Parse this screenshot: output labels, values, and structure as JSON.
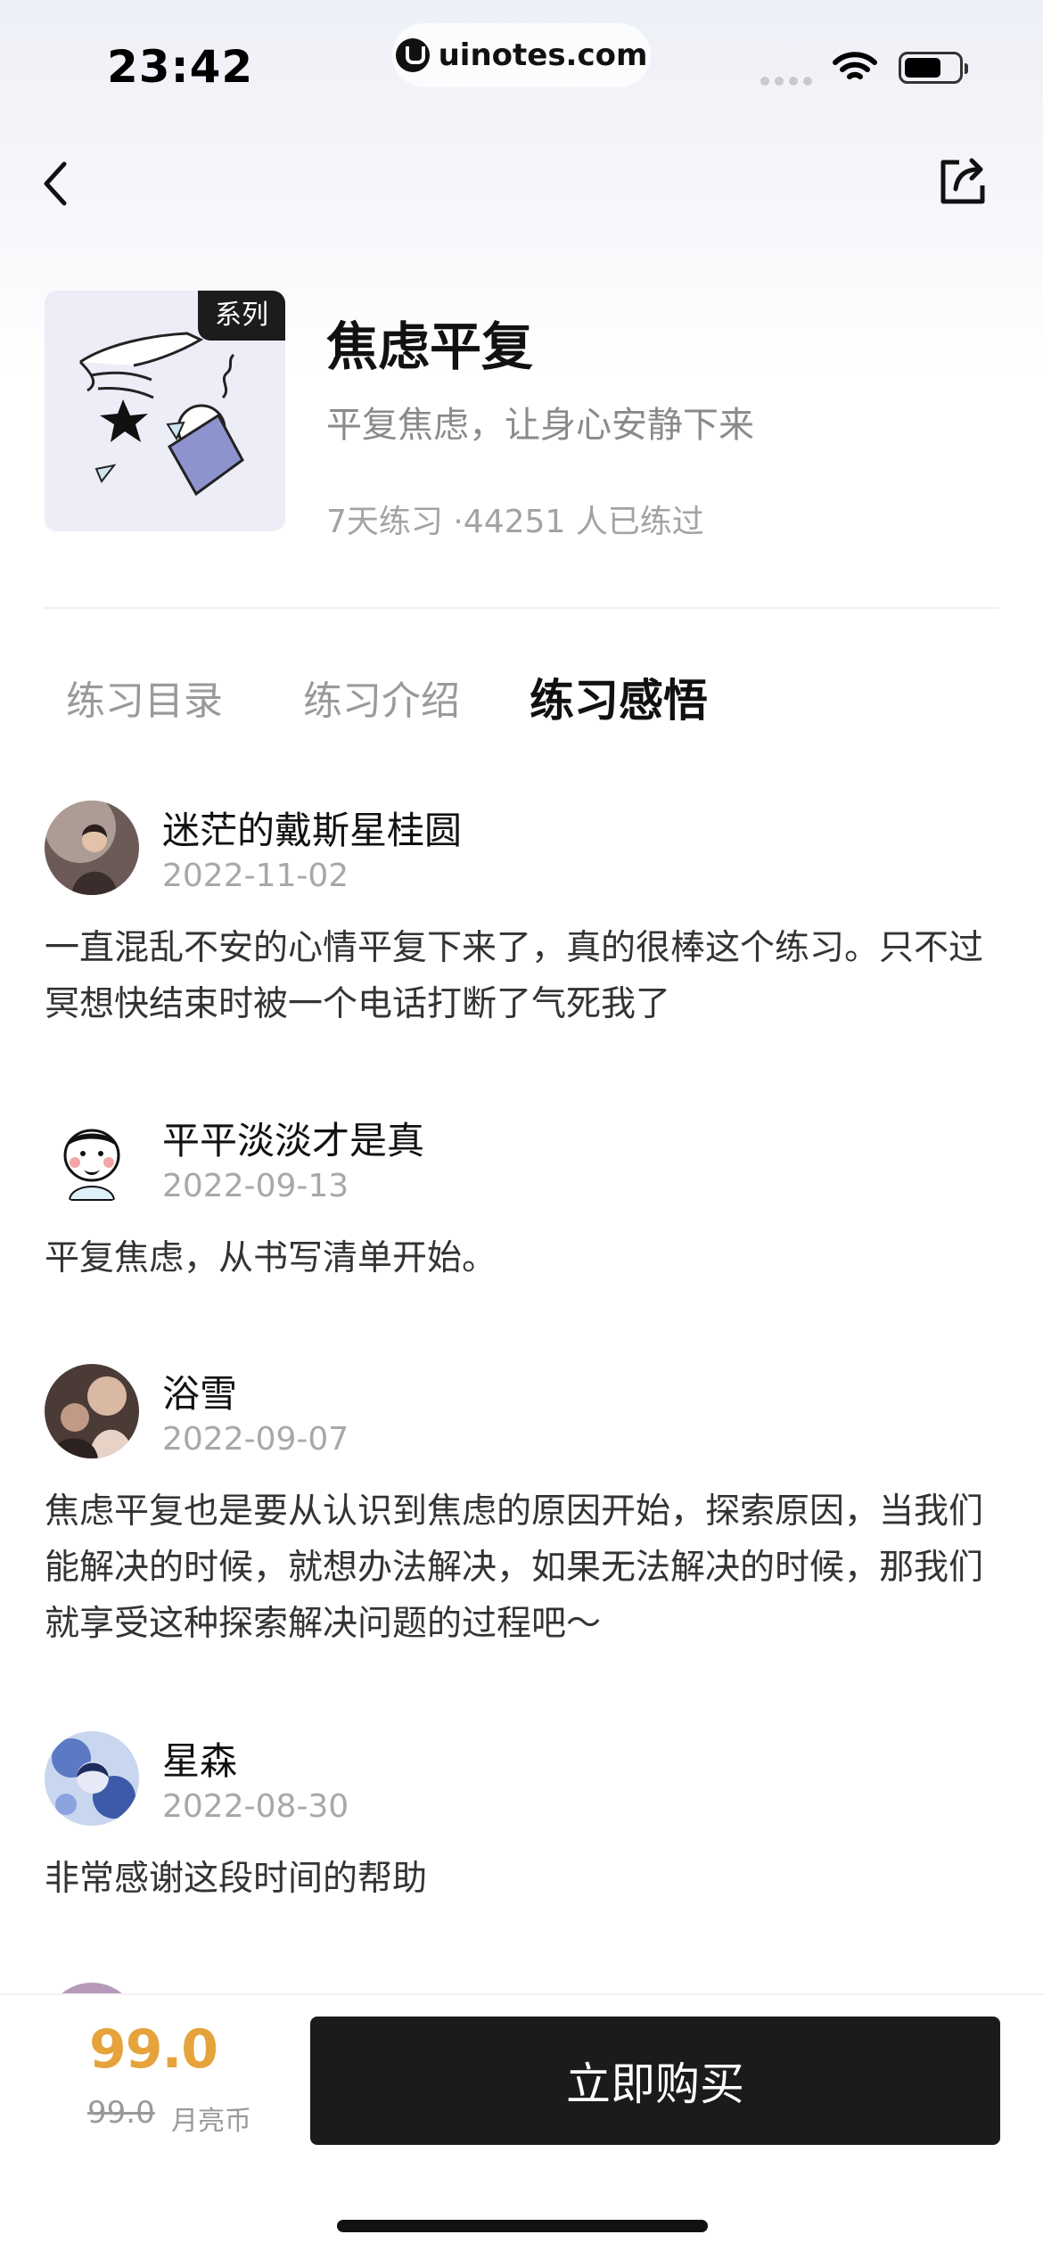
{
  "status_bar": {
    "time": "23:42",
    "url": "uinotes.com"
  },
  "header": {
    "series_tag": "系列",
    "title": "焦虑平复",
    "subtitle": "平复焦虑，让身心安静下来",
    "meta": "7天练习 ·44251 人已练过"
  },
  "tabs": [
    {
      "label": "练习目录",
      "active": false
    },
    {
      "label": "练习介绍",
      "active": false
    },
    {
      "label": "练习感悟",
      "active": true
    }
  ],
  "reviews": [
    {
      "name": "迷茫的戴斯星桂圆",
      "date": "2022-11-02",
      "text": "一直混乱不安的心情平复下来了，真的很棒这个练习。只不过冥想快结束时被一个电话打断了气死我了"
    },
    {
      "name": "平平淡淡才是真",
      "date": "2022-09-13",
      "text": "平复焦虑，从书写清单开始。"
    },
    {
      "name": "浴雪",
      "date": "2022-09-07",
      "text": "焦虑平复也是要从认识到焦虑的原因开始，探索原因，当我们能解决的时候，就想办法解决，如果无法解决的时候，那我们就享受这种探索解决问题的过程吧～"
    },
    {
      "name": "星森",
      "date": "2022-08-30",
      "text": "非常感谢这段时间的帮助"
    }
  ],
  "purchase": {
    "price": "99.0",
    "original_price": "99.0",
    "unit": "月亮币",
    "buy_label": "立即购买",
    "price_color": "#e6a33c"
  }
}
